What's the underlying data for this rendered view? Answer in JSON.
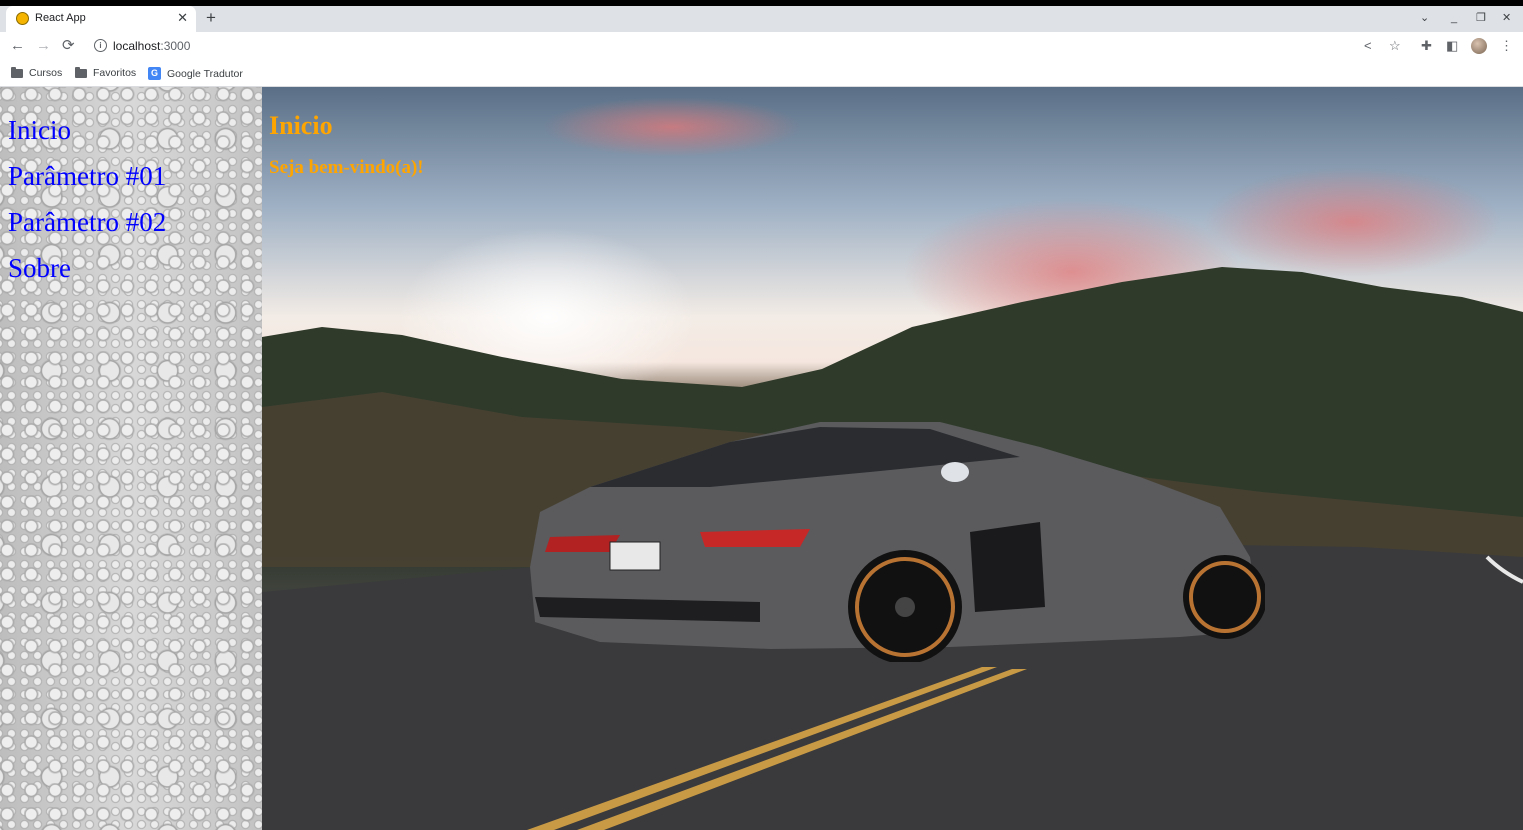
{
  "browser": {
    "tab_title": "React App",
    "tab_close": "✕",
    "new_tab": "+",
    "url_host": "localhost",
    "url_port": ":3000",
    "bookmarks": [
      {
        "label": "Cursos",
        "icon": "folder-icon"
      },
      {
        "label": "Favoritos",
        "icon": "folder-icon"
      },
      {
        "label": "Google Tradutor",
        "icon": "google-translate-icon"
      }
    ]
  },
  "sidebar": {
    "links": [
      "Inicio",
      "Parâmetro #01",
      "Parâmetro #02",
      "Sobre"
    ]
  },
  "main": {
    "title": "Inicio",
    "subtitle": "Seja bem-vindo(a)!"
  },
  "colors": {
    "link": "#0000ff",
    "heading": "#ffa500"
  }
}
